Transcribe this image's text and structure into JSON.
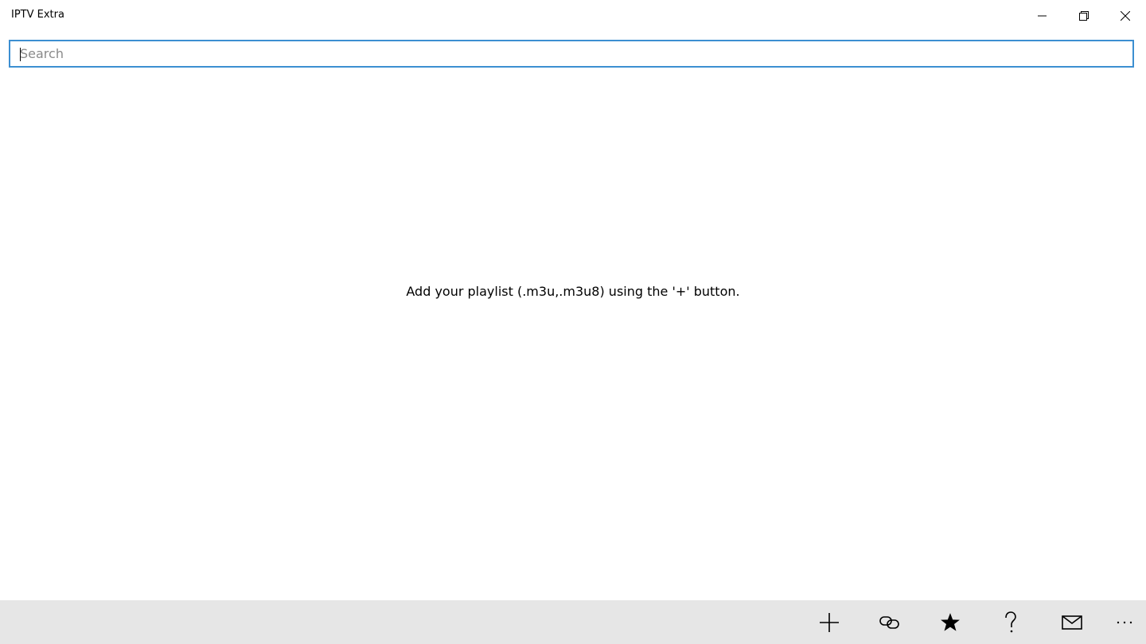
{
  "window": {
    "title": "IPTV Extra"
  },
  "search": {
    "placeholder": "Search",
    "value": ""
  },
  "main": {
    "empty_message": "Add your playlist (.m3u,.m3u8) using the '+' button."
  },
  "command_bar": {
    "buttons": [
      {
        "icon": "add-icon"
      },
      {
        "icon": "link-icon"
      },
      {
        "icon": "star-icon"
      },
      {
        "icon": "help-icon"
      },
      {
        "icon": "mail-icon"
      },
      {
        "icon": "more-icon"
      }
    ]
  },
  "window_controls": [
    {
      "icon": "minimize-icon"
    },
    {
      "icon": "restore-icon"
    },
    {
      "icon": "close-icon"
    }
  ]
}
